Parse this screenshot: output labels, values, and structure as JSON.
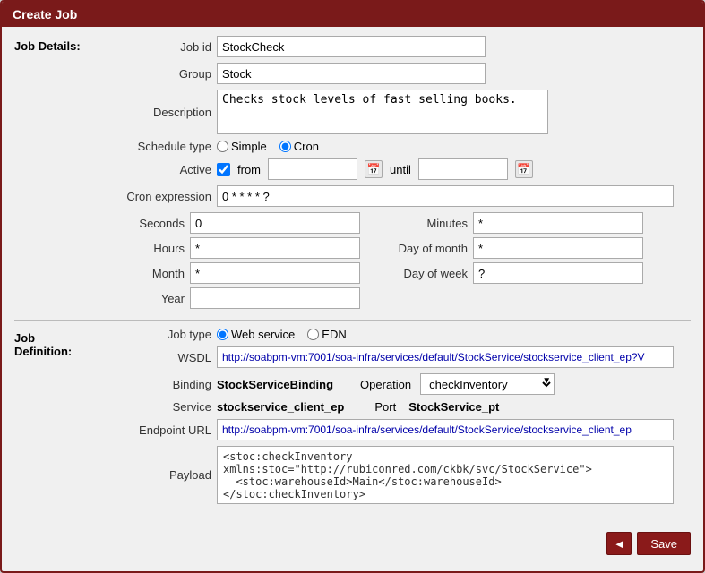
{
  "window": {
    "title": "Create Job"
  },
  "jobDetails": {
    "label": "Job Details:",
    "jobId": {
      "label": "Job id",
      "value": "StockCheck"
    },
    "group": {
      "label": "Group",
      "value": "Stock"
    },
    "description": {
      "label": "Description",
      "value": "Checks stock levels of fast selling books."
    },
    "scheduleType": {
      "label": "Schedule type",
      "options": [
        "Simple",
        "Cron"
      ],
      "selected": "Cron"
    },
    "active": {
      "label": "Active",
      "checked": true,
      "from_label": "from",
      "until_label": "until"
    },
    "cronExpression": {
      "label": "Cron expression",
      "value": "0 * * * * ?"
    },
    "seconds": {
      "label": "Seconds",
      "value": "0"
    },
    "minutes": {
      "label": "Minutes",
      "value": "*"
    },
    "hours": {
      "label": "Hours",
      "value": "*"
    },
    "dayOfMonth": {
      "label": "Day of month",
      "value": "*"
    },
    "month": {
      "label": "Month",
      "value": "*"
    },
    "dayOfWeek": {
      "label": "Day of week",
      "value": "?"
    },
    "year": {
      "label": "Year",
      "value": ""
    }
  },
  "jobDefinition": {
    "label": "Job Definition:",
    "jobType": {
      "label": "Job type",
      "options": [
        "Web service",
        "EDN"
      ],
      "selected": "Web service"
    },
    "wsdl": {
      "label": "WSDL",
      "value": "http://soabpm-vm:7001/soa-infra/services/default/StockService/stockservice_client_ep?V"
    },
    "binding": {
      "label": "Binding",
      "value": "StockServiceBinding"
    },
    "operation": {
      "label": "Operation",
      "value": "checkInventory",
      "options": [
        "checkInventory"
      ]
    },
    "service": {
      "label": "Service",
      "value": "stockservice_client_ep"
    },
    "port": {
      "label": "Port",
      "value": "StockService_pt"
    },
    "endpointUrl": {
      "label": "Endpoint URL",
      "value": "http://soabpm-vm:7001/soa-infra/services/default/StockService/stockservice_client_ep"
    },
    "payload": {
      "label": "Payload",
      "value": "<stoc:checkInventory xmlns:stoc=\"http://rubiconred.com/ckbk/svc/StockService\">\n  <stoc:warehouseId>Main</stoc:warehouseId>\n</stoc:checkInventory>"
    }
  },
  "buttons": {
    "back_label": "◄",
    "save_label": "Save"
  }
}
